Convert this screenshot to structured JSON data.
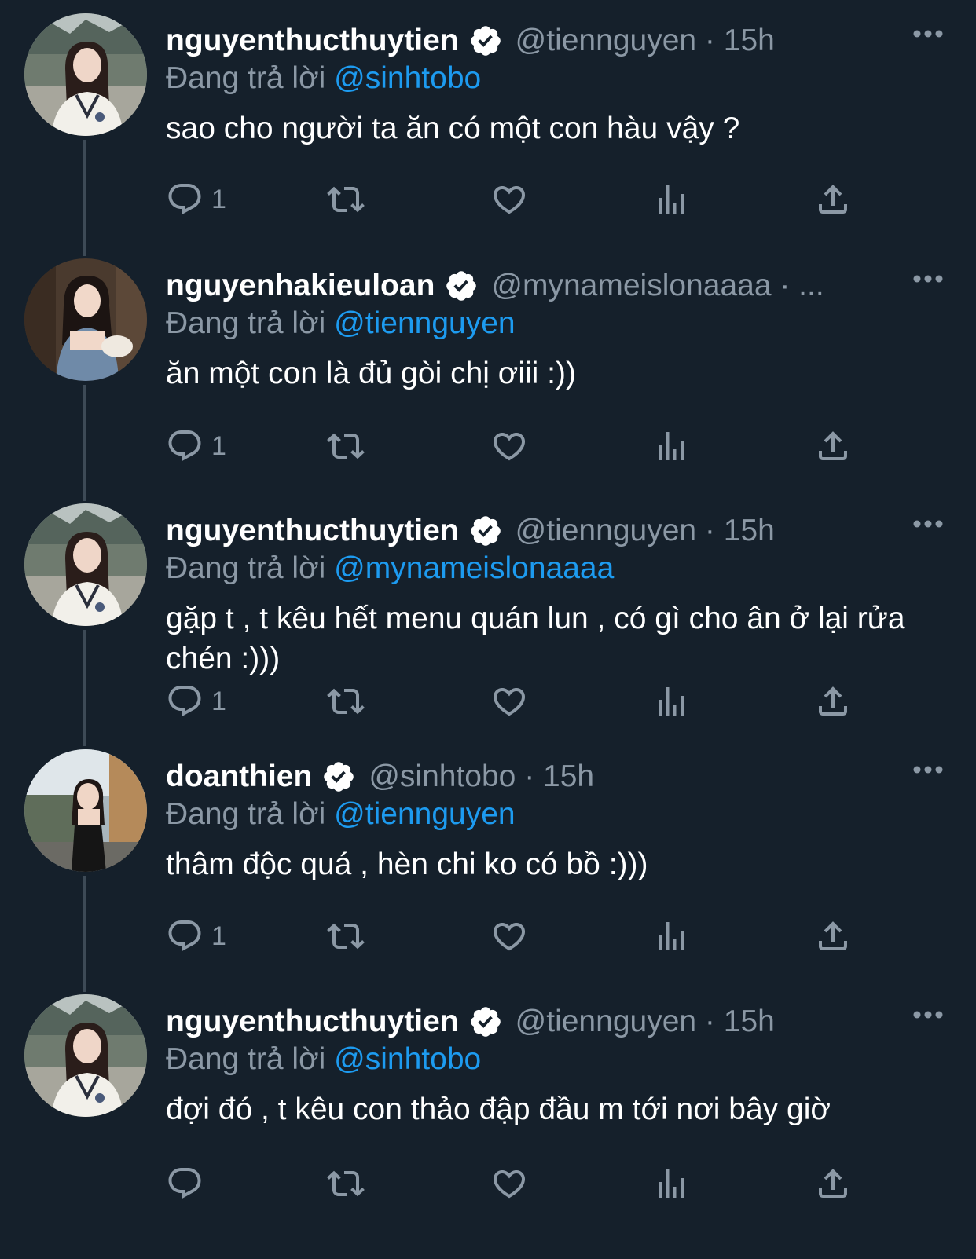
{
  "reply_prefix": "Đang trả lời",
  "colors": {
    "background": "#15202b",
    "mention": "#1d9bf0",
    "muted": "#8b98a5",
    "verified": "#ffffff"
  },
  "icons": [
    "comment-icon",
    "retweet-icon",
    "like-icon",
    "views-icon",
    "share-icon",
    "verified-icon",
    "more-icon"
  ],
  "tweets": [
    {
      "name": "nguyenthucthuytien",
      "handle_time": "@tiennguyen · 15h",
      "reply_to": "@sinhtobo",
      "text": "sao cho người ta ăn có một con hàu vậy ?",
      "reply_count": "1"
    },
    {
      "name": "nguyenhakieuloan",
      "handle_time": "@mynameislonaaaa · ...",
      "reply_to": "@tiennguyen",
      "text": "ăn một con là đủ gòi chị ơiii :))",
      "reply_count": "1"
    },
    {
      "name": "nguyenthucthuytien",
      "handle_time": "@tiennguyen · 15h",
      "reply_to": "@mynameislonaaaa",
      "text": "gặp t , t kêu hết menu quán lun , có gì cho ân ở lại rửa chén :)))",
      "reply_count": "1"
    },
    {
      "name": "doanthien",
      "handle_time": "@sinhtobo · 15h",
      "reply_to": "@tiennguyen",
      "text": "thâm độc quá , hèn chi ko có bồ :)))",
      "reply_count": "1"
    },
    {
      "name": "nguyenthucthuytien",
      "handle_time": "@tiennguyen · 15h",
      "reply_to": "@sinhtobo",
      "text": "đợi đó , t kêu con thảo đập đầu m tới nơi bây giờ",
      "reply_count": ""
    }
  ]
}
